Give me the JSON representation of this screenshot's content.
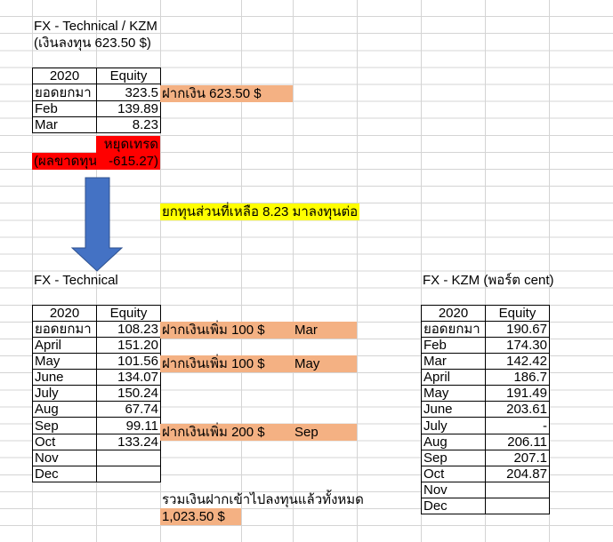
{
  "section1": {
    "title": "FX - Technical / KZM",
    "subtitle": "(เงินลงทุน 623.50 $)",
    "table": {
      "header": [
        "2020",
        "Equity"
      ],
      "rows": [
        [
          "ยอดยกมา",
          "323.5"
        ],
        [
          "Feb",
          "139.89"
        ],
        [
          "Mar",
          "8.23"
        ]
      ]
    },
    "deposit_note": "ฝากเงิน  623.50 $",
    "stop_trade": "หยุดเทรด",
    "loss_label": "(ผลขาดทุน",
    "loss_value": "-615.27)",
    "carry_note": "ยกทุนส่วนที่เหลือ 8.23 มาลงทุนต่อ"
  },
  "section2": {
    "title": "FX - Technical",
    "table": {
      "header": [
        "2020",
        "Equity"
      ],
      "rows": [
        [
          "ยอดยกมา",
          "108.23"
        ],
        [
          "April",
          "151.20"
        ],
        [
          "May",
          "101.56"
        ],
        [
          "June",
          "134.07"
        ],
        [
          "July",
          "150.24"
        ],
        [
          "Aug",
          "67.74"
        ],
        [
          "Sep",
          "99.11"
        ],
        [
          "Oct",
          "133.24"
        ],
        [
          "Nov",
          ""
        ],
        [
          "Dec",
          ""
        ]
      ]
    },
    "deposits": [
      {
        "label": "ฝากเงินเพิ่ม 100 $",
        "month": "Mar"
      },
      {
        "label": "ฝากเงินเพิ่ม 100 $",
        "month": "May"
      },
      {
        "label": "ฝากเงินเพิ่ม 200 $",
        "month": "Sep"
      }
    ],
    "total_label": "รวมเงินฝากเข้าไปลงทุนแล้วทั้งหมด",
    "total_value": "1,023.50 $"
  },
  "section3": {
    "title": "FX - KZM (พอร์ต cent)",
    "table": {
      "header": [
        "2020",
        "Equity"
      ],
      "rows": [
        [
          "ยอดยกมา",
          "190.67"
        ],
        [
          "Feb",
          "174.30"
        ],
        [
          "Mar",
          "142.42"
        ],
        [
          "April",
          "186.7"
        ],
        [
          "May",
          "191.49"
        ],
        [
          "June",
          "203.61"
        ],
        [
          "July",
          "-"
        ],
        [
          "Aug",
          "206.11"
        ],
        [
          "Sep",
          "207.1"
        ],
        [
          "Oct",
          "204.87"
        ],
        [
          "Nov",
          ""
        ],
        [
          "Dec",
          ""
        ]
      ]
    }
  },
  "colors": {
    "deposit": "#f4b183",
    "loss": "#ff0000",
    "note": "#ffff00",
    "arrow": "#4472c4"
  },
  "icons": {
    "arrow": "down-arrow-shape"
  }
}
